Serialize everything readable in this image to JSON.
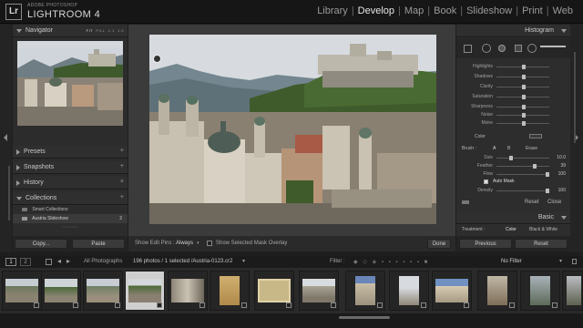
{
  "app": {
    "vendor": "ADOBE PHOTOSHOP",
    "name": "LIGHTROOM 4",
    "logo": "Lr"
  },
  "modules": [
    {
      "label": "Library",
      "active": false
    },
    {
      "label": "Develop",
      "active": true
    },
    {
      "label": "Map",
      "active": false
    },
    {
      "label": "Book",
      "active": false
    },
    {
      "label": "Slideshow",
      "active": false
    },
    {
      "label": "Print",
      "active": false
    },
    {
      "label": "Web",
      "active": false
    }
  ],
  "left_panel": {
    "navigator": {
      "title": "Navigator",
      "zoom_options": [
        "FIT",
        "FILL",
        "1:1",
        "1:3"
      ]
    },
    "sections": [
      {
        "label": "Presets",
        "action": "+"
      },
      {
        "label": "Snapshots",
        "action": "+"
      },
      {
        "label": "History",
        "action": "×"
      },
      {
        "label": "Collections",
        "action": "+"
      }
    ],
    "collections": [
      {
        "label": "Smart Collections",
        "count": ""
      },
      {
        "label": "Austria Slideshow",
        "count": "2"
      }
    ],
    "copy_label": "Copy...",
    "paste_label": "Paste"
  },
  "toolbar": {
    "show_edit_pins_label": "Show Edit Pins :",
    "show_edit_pins_value": "Always",
    "mask_overlay_label": "Show Selected Mask Overlay",
    "done_label": "Done"
  },
  "right_panel": {
    "histogram_title": "Histogram",
    "tone_sliders": [
      {
        "label": "Highlights",
        "value": ""
      },
      {
        "label": "Shadows",
        "value": ""
      },
      {
        "label": "Clarity",
        "value": ""
      },
      {
        "label": "Saturation",
        "value": ""
      }
    ],
    "detail_sliders": [
      {
        "label": "Sharpness",
        "value": ""
      },
      {
        "label": "Noise",
        "value": ""
      },
      {
        "label": "Moire",
        "value": ""
      }
    ],
    "color_label": "Color",
    "brush": {
      "label": "Brush :",
      "options": [
        "A",
        "B",
        "Erase"
      ],
      "sliders": [
        {
          "label": "Size",
          "value": "10.0"
        },
        {
          "label": "Feather",
          "value": "39"
        },
        {
          "label": "Flow",
          "value": "100"
        },
        {
          "label": "Density",
          "value": "100"
        }
      ],
      "auto_mask_label": "Auto Mask"
    },
    "reset_label": "Reset",
    "close_label": "Close",
    "basic_title": "Basic",
    "treatment_label": "Treatment :",
    "treatment_color": "Color",
    "treatment_bw": "Black & White",
    "previous_label": "Previous",
    "reset_button_label": "Reset"
  },
  "filmstrip_bar": {
    "pages": [
      "1",
      "2"
    ],
    "source": "All Photographs",
    "info": "196 photos / 1 selected /Austria-0123.cr2",
    "filter_label": "Filter :",
    "filter_value": "No Filter"
  },
  "colors": {
    "active_module": "#e6e6e6",
    "panel_bg": "#2c2c2c",
    "center_bg": "#3b3b3b"
  }
}
